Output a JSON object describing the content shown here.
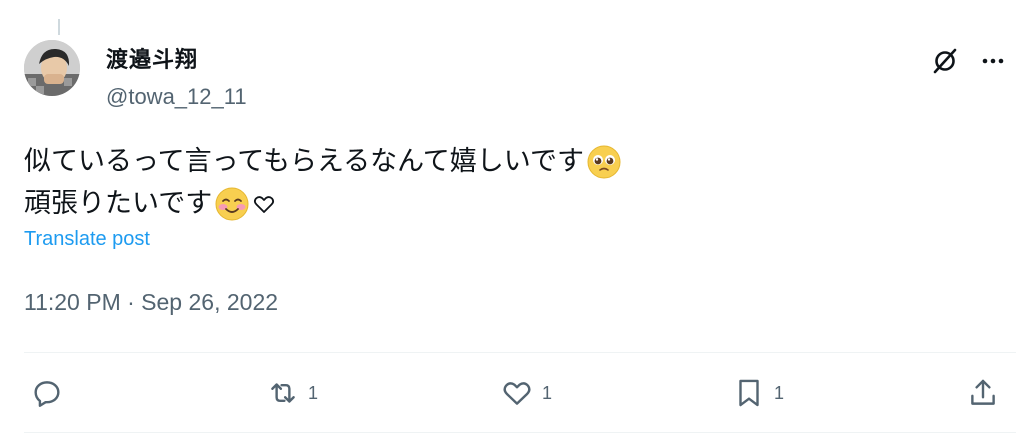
{
  "author": {
    "display_name": "渡邉斗翔",
    "handle": "@towa_12_11"
  },
  "post": {
    "text_line_1": "似ているって言ってもらえるなんて嬉しいです",
    "text_line_2": "頑張りたいです",
    "emoji_1": "pleading-face",
    "emoji_2": "smiling-face-with-blush",
    "emoji_3": "white-heart"
  },
  "translate_label": "Translate post",
  "timestamp": "11:20 PM · Sep 26, 2022",
  "actions": {
    "replies": "",
    "reposts": "1",
    "likes": "1",
    "bookmarks": "1"
  },
  "colors": {
    "link": "#1d9bf0",
    "secondary_text": "#536471",
    "primary_text": "#0f1419",
    "divider": "#eff3f4"
  }
}
